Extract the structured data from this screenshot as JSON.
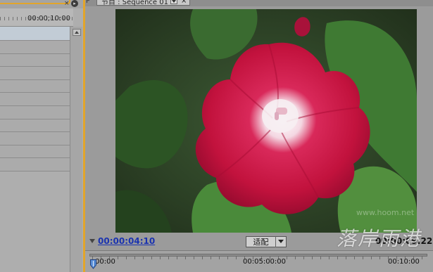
{
  "timeline_panel": {
    "ruler_timecode": "00:00;10:00",
    "track_count": 11
  },
  "program_monitor": {
    "tab_title": "节目 : Sequence 01",
    "current_timecode": "00:00:04:10",
    "fit_select": {
      "selected": "适配"
    },
    "duration_timecode": "00:00:09:22",
    "time_ruler": {
      "labels": [
        "00:00",
        "00:05:00:00",
        "00:10:00"
      ]
    },
    "frame": {
      "subject": "red morning glory flower",
      "colors": {
        "background": "#2f4a28",
        "petal": "#c2123d",
        "center": "#f3e8ee"
      }
    }
  },
  "watermark": {
    "text": "落岸雨港",
    "url": "www.hoom.net"
  },
  "colors": {
    "active_panel_border": "#e2a52a",
    "timecode_link": "#1a33b0",
    "panel_bg": "#9b9b9b"
  }
}
